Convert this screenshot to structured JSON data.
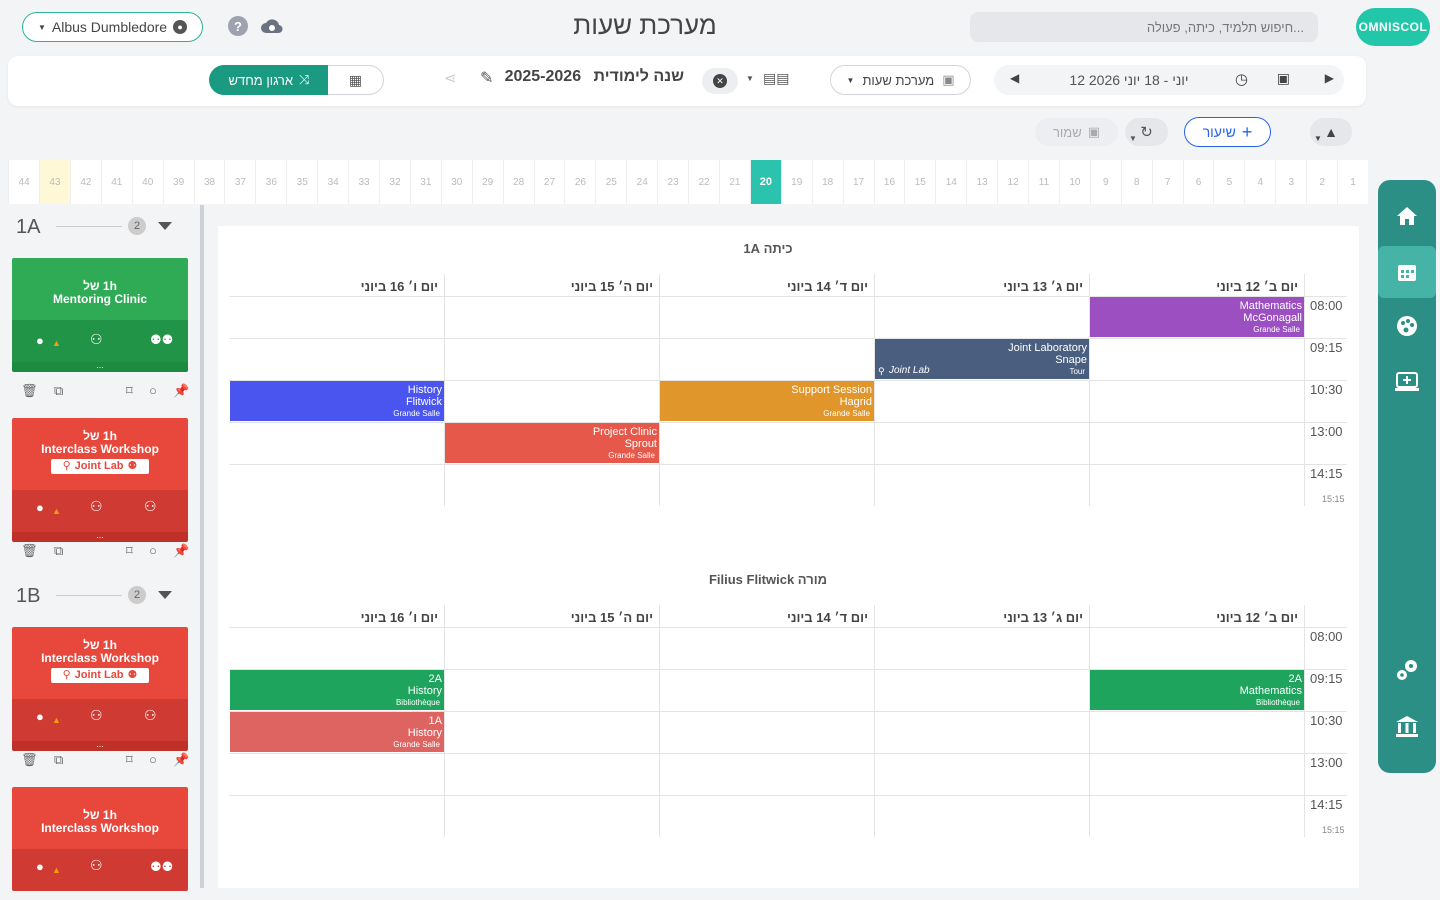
{
  "app": {
    "title": "מערכת שעות",
    "logo": "OMNISCOL",
    "search_placeholder": "...חיפוש תלמיד, כיתה, פעולה",
    "user_name": "Albus Dumbledore"
  },
  "toolbar": {
    "week_range": "12 יוני - 18 יוני 2026",
    "timetable_select": "מערכת שעות",
    "year_label": "שנה לימודית",
    "year_value": "2025-2026",
    "reorganize_label": "ארגון מחדש"
  },
  "actions": {
    "add_lesson": "שיעור",
    "save": "שמור"
  },
  "week_strip": {
    "weeks": [
      "1",
      "2",
      "3",
      "4",
      "5",
      "6",
      "7",
      "8",
      "9",
      "10",
      "11",
      "12",
      "13",
      "14",
      "15",
      "16",
      "17",
      "18",
      "19",
      "20",
      "21",
      "22",
      "23",
      "24",
      "25",
      "26",
      "27",
      "28",
      "29",
      "30",
      "31",
      "32",
      "33",
      "34",
      "35",
      "36",
      "37",
      "38",
      "39",
      "40",
      "41",
      "42",
      "43",
      "44"
    ],
    "current": "20",
    "highlighted": "43"
  },
  "left_panel": {
    "groups": [
      {
        "name": "1A",
        "count": "2"
      },
      {
        "name": "1B",
        "count": "2"
      }
    ],
    "cards": [
      {
        "duration": "1h של",
        "title": "Mentoring Clinic",
        "tag": ""
      },
      {
        "duration": "1h של",
        "title": "Interclass Workshop",
        "tag": "Joint Lab"
      },
      {
        "duration": "1h של",
        "title": "Interclass Workshop",
        "tag": "Joint Lab"
      },
      {
        "duration": "1h של",
        "title": "Interclass Workshop",
        "tag": ""
      }
    ]
  },
  "schedule": {
    "days": [
      "יום ב׳ 12 ביוני",
      "יום ג׳ 13 ביוני",
      "יום ד׳ 14 ביוני",
      "יום ה׳ 15 ביוני",
      "יום ו׳ 16 ביוני"
    ],
    "times": [
      "08:00",
      "09:15",
      "10:30",
      "13:00",
      "14:15"
    ],
    "end_time": "15:15",
    "sections": [
      {
        "title": "כיתה 1A",
        "events": [
          {
            "subject": "Mathematics",
            "teacher": "McGonagall",
            "room": "Grande Salle",
            "color": "#9b4fc1"
          },
          {
            "subject": "Joint Laboratory",
            "teacher": "Snape",
            "room": "Tour",
            "tag": "Joint Lab",
            "color": "#4a5e7f"
          },
          {
            "subject": "History",
            "teacher": "Flitwick",
            "room": "Grande Salle",
            "color": "#4a55f0"
          },
          {
            "subject": "Support Session",
            "teacher": "Hagrid",
            "room": "Grande Salle",
            "color": "#e0962a"
          },
          {
            "subject": "Project Clinic",
            "teacher": "Sprout",
            "room": "Grande Salle",
            "color": "#e5584a"
          }
        ]
      },
      {
        "title": "מורה Filius Flitwick",
        "events": [
          {
            "subject": "2A",
            "teacher": "Mathematics",
            "room": "Bibliothèque",
            "color": "#1fa45d"
          },
          {
            "subject": "2A",
            "teacher": "History",
            "room": "Bibliothèque",
            "color": "#1fa45d"
          },
          {
            "subject": "1A",
            "teacher": "History",
            "room": "Grande Salle",
            "color": "#de6461"
          }
        ]
      }
    ]
  }
}
